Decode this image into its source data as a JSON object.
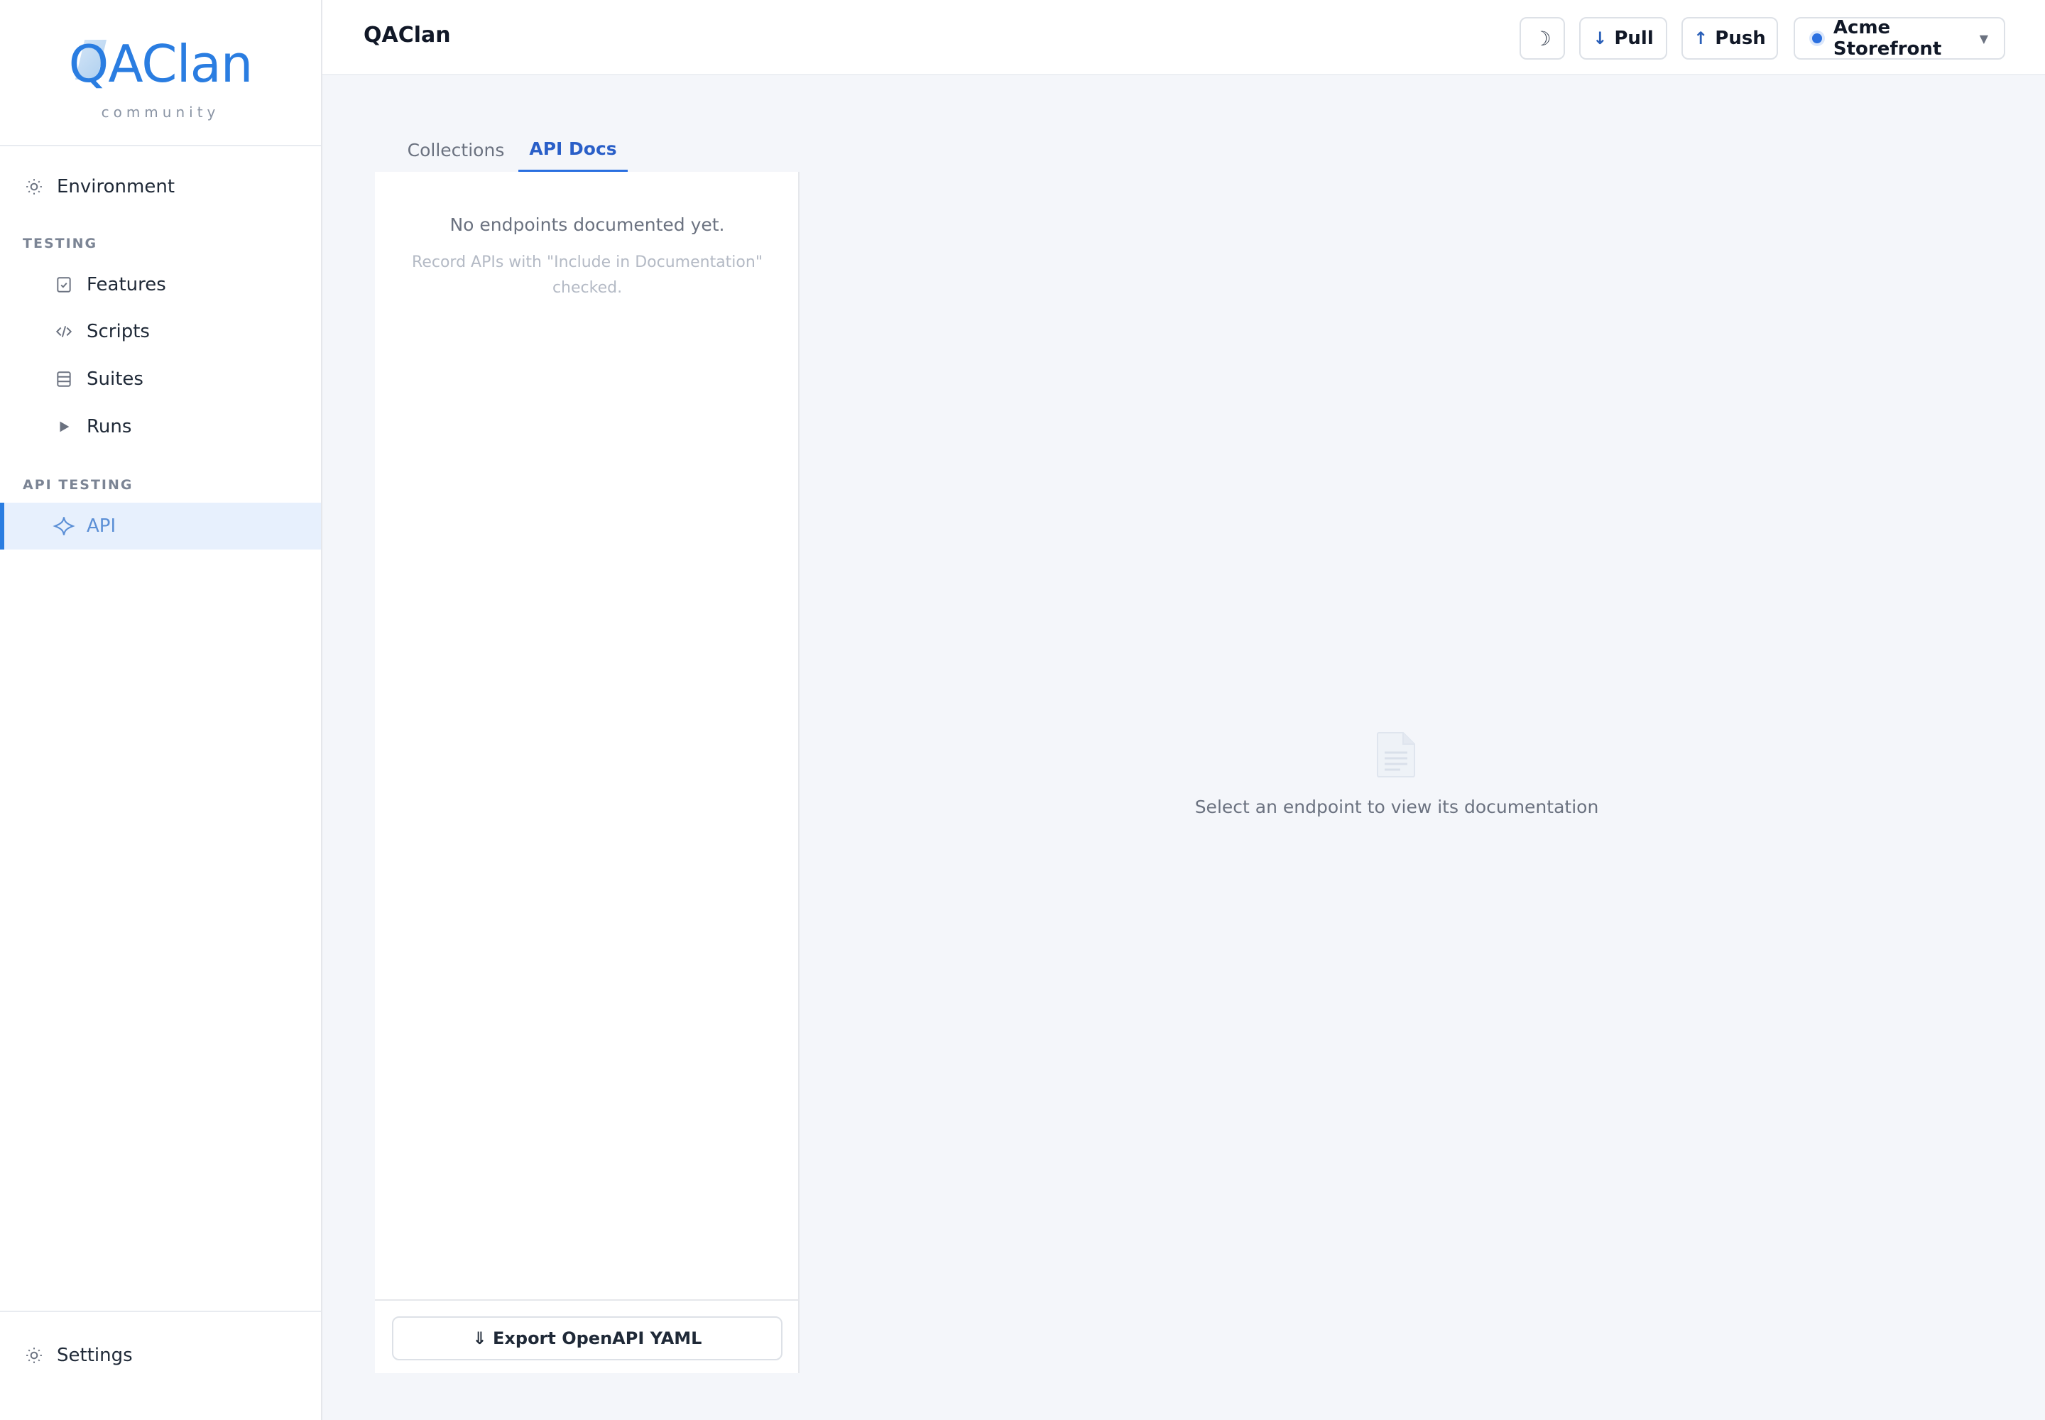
{
  "brand": {
    "logo_text": "QAClan",
    "logo_subtitle": "community",
    "accent_color": "#2a7de1"
  },
  "sidebar": {
    "environment_label": "Environment",
    "sections": [
      {
        "title": "TESTING",
        "items": [
          {
            "label": "Features",
            "icon": "checklist-icon"
          },
          {
            "label": "Scripts",
            "icon": "code-icon"
          },
          {
            "label": "Suites",
            "icon": "stack-icon"
          },
          {
            "label": "Runs",
            "icon": "play-icon"
          }
        ]
      },
      {
        "title": "API TESTING",
        "items": [
          {
            "label": "API",
            "icon": "sparkle-icon",
            "active": true
          }
        ]
      }
    ],
    "settings_label": "Settings"
  },
  "header": {
    "title": "QAClan",
    "theme_toggle_glyph": "☽",
    "pull_label": "Pull",
    "push_label": "Push",
    "project_label": "Acme Storefront"
  },
  "tabs": [
    {
      "label": "Collections",
      "active": false
    },
    {
      "label": "API Docs",
      "active": true
    }
  ],
  "docs_panel": {
    "empty_title": "No endpoints documented yet.",
    "empty_hint": "Record APIs with \"Include in Documentation\" checked.",
    "export_label": "⇓ Export OpenAPI YAML"
  },
  "main": {
    "empty_message": "Select an endpoint to view its documentation"
  }
}
